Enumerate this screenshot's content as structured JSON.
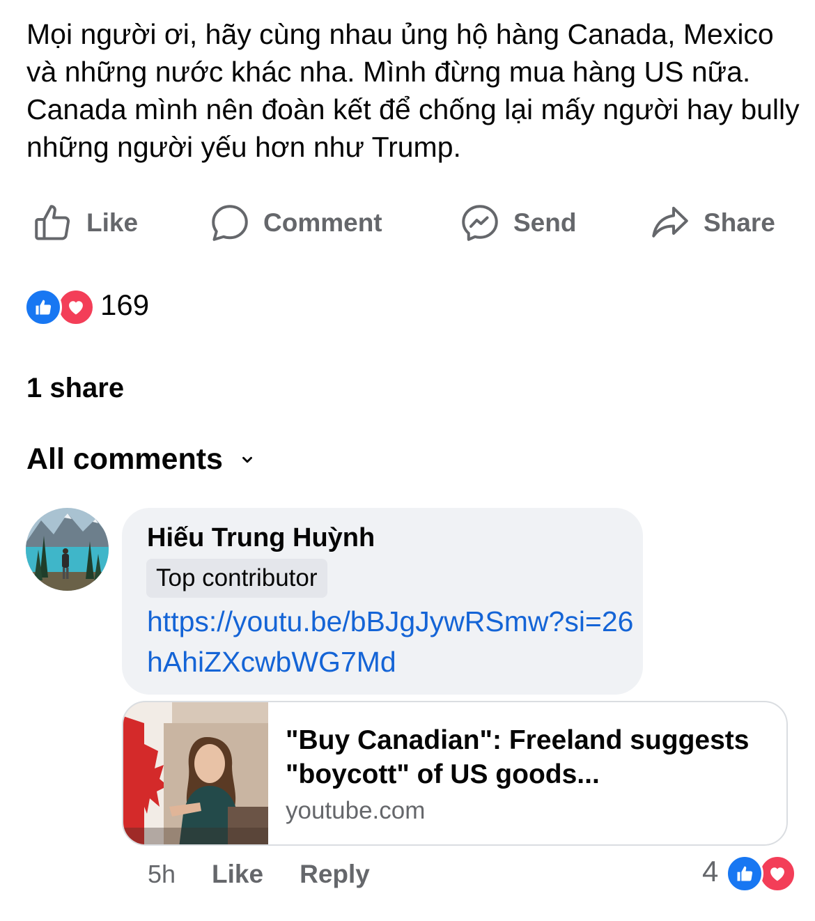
{
  "post": {
    "text": "Mọi người ơi, hãy cùng nhau ủng hộ hàng Canada, Mexico và những nước khác nha. Mình đừng mua hàng US nữa. Canada mình nên đoàn kết để chống lại mấy người hay bully những người yếu hơn như Trump."
  },
  "actions": {
    "like": "Like",
    "comment": "Comment",
    "send": "Send",
    "share": "Share"
  },
  "reactions": {
    "count": "169",
    "types": [
      "like",
      "love"
    ]
  },
  "shares": "1 share",
  "comments_sort": {
    "label": "All comments"
  },
  "comment": {
    "author": "Hiếu Trung Huỳnh",
    "badge": "Top contributor",
    "link": "https://youtu.be/bBJgJywRSmw?si=26hAhiZXcwbWG7Md",
    "preview": {
      "title": "\"Buy Canadian\": Freeland suggests \"boycott\" of US goods...",
      "domain": "youtube.com"
    },
    "time": "5h",
    "like_label": "Like",
    "reply_label": "Reply",
    "reaction_count": "4",
    "reaction_types": [
      "like",
      "love"
    ]
  },
  "colors": {
    "accent_blue": "#1877f2",
    "link_blue": "#1464d6",
    "love_red": "#f33e58",
    "secondary_text": "#65676b",
    "bubble_bg": "#f0f2f5"
  }
}
